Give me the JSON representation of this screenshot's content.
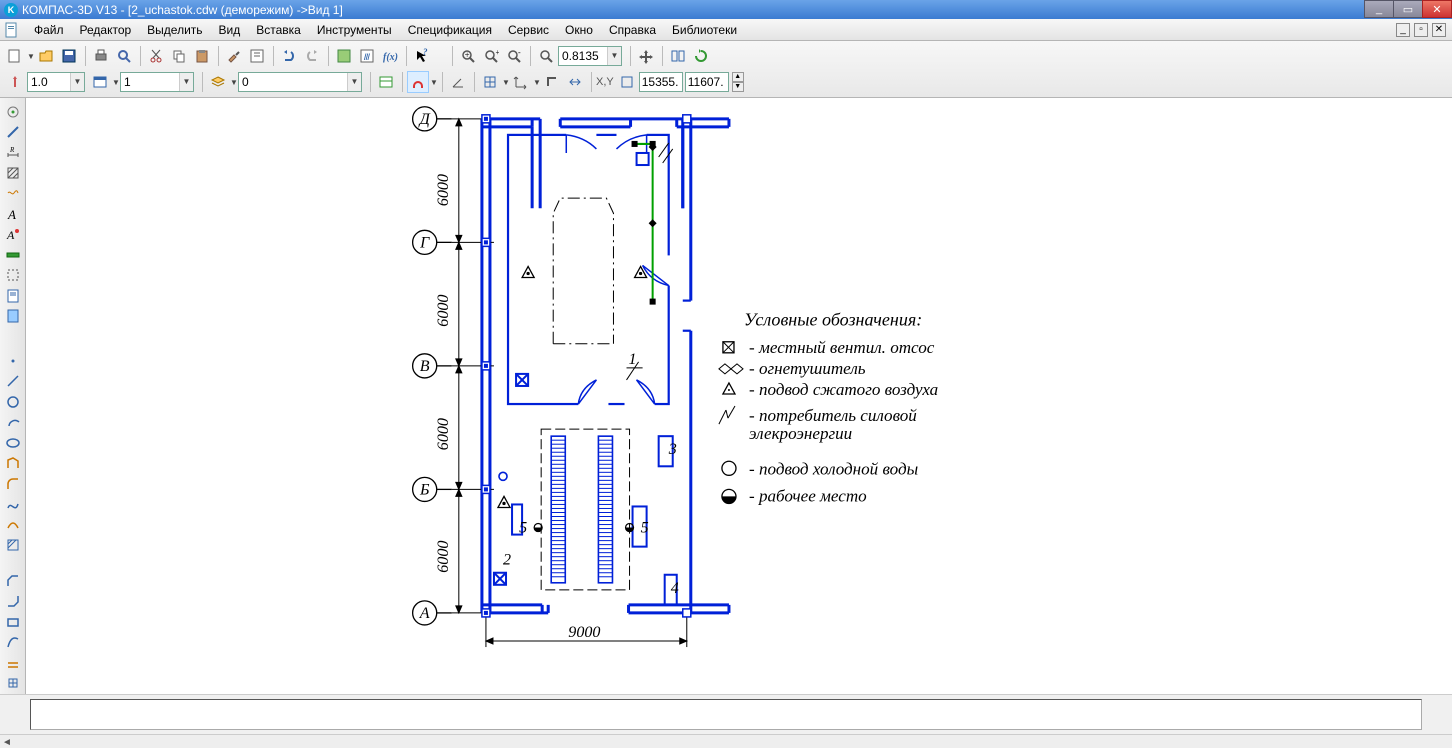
{
  "window": {
    "title": "КОМПАС-3D V13 - [2_uchastok.cdw (деморежим) ->Вид 1]"
  },
  "menu": {
    "file": "Файл",
    "edit": "Редактор",
    "select": "Выделить",
    "view": "Вид",
    "insert": "Вставка",
    "tools": "Инструменты",
    "spec": "Спецификация",
    "service": "Сервис",
    "window": "Окно",
    "help": "Справка",
    "libs": "Библиотеки"
  },
  "toolbar1": {
    "zoom": "0.8135"
  },
  "toolbar2": {
    "lineweight": "1.0",
    "layer": "1",
    "something": "0",
    "coord_x": "15355.",
    "coord_y": "11607."
  },
  "drawing": {
    "grid_labels": {
      "a": "А",
      "b": "Б",
      "v": "В",
      "g": "Г",
      "d": "Д"
    },
    "dims": {
      "h1": "6000",
      "h2": "6000",
      "h3": "6000",
      "h4": "6000",
      "w": "9000"
    },
    "item_ids": {
      "n1": "1",
      "n2": "2",
      "n3": "3",
      "n4": "4",
      "n5a": "5",
      "n5b": "5"
    },
    "legend": {
      "title": "Условные обозначения:",
      "l1": "- местный вентил. отсос",
      "l2": "- огнетушитель",
      "l3": "- подвод сжатого воздуха",
      "l4": "- потребитель силовой",
      "l4b": "элекроэнергии",
      "l5": "- подвод холодной воды",
      "l6": "- рабочее место"
    }
  }
}
